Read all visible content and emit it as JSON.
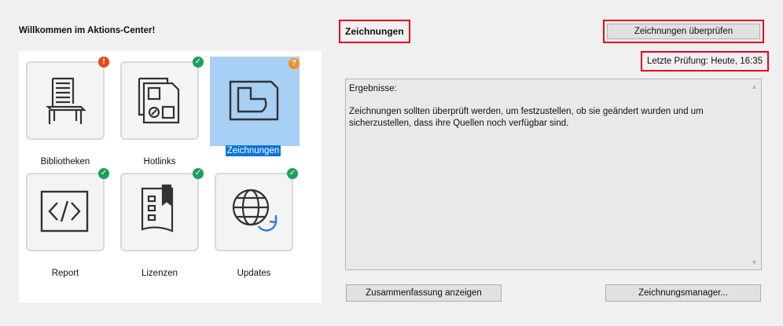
{
  "welcome": "Willkommen im Aktions-Center!",
  "tiles": [
    {
      "label": "Bibliotheken",
      "status": "error",
      "badge": "!",
      "icon": "chair-icon"
    },
    {
      "label": "Hotlinks",
      "status": "ok",
      "badge": "✓",
      "icon": "hotlink-documents-icon"
    },
    {
      "label": "Zeichnungen",
      "status": "warning",
      "badge": "?",
      "icon": "drawing-icon",
      "selected": true
    },
    {
      "label": "Report",
      "status": "ok",
      "badge": "✓",
      "icon": "code-report-icon"
    },
    {
      "label": "Lizenzen",
      "status": "ok",
      "badge": "✓",
      "icon": "license-icon"
    },
    {
      "label": "Updates",
      "status": "ok",
      "badge": "✓",
      "icon": "globe-update-icon"
    }
  ],
  "section": {
    "title": "Zeichnungen"
  },
  "check_button": "Zeichnungen überprüfen",
  "last_check": "Letzte Prüfung: Heute, 16:35",
  "results": {
    "heading": "Ergebnisse:",
    "body": "Zeichnungen sollten überprüft werden, um festzustellen, ob sie geändert wurden und um sicherzustellen, dass ihre Quellen noch verfügbar sind."
  },
  "summary_button": "Zusammenfassung anzeigen",
  "manager_button": "Zeichnungsmanager...",
  "colors": {
    "ok": "#1fa05a",
    "error": "#e34a1b",
    "warning": "#f39125",
    "selected": "#a8d0f5",
    "highlight": "#e8001c"
  }
}
